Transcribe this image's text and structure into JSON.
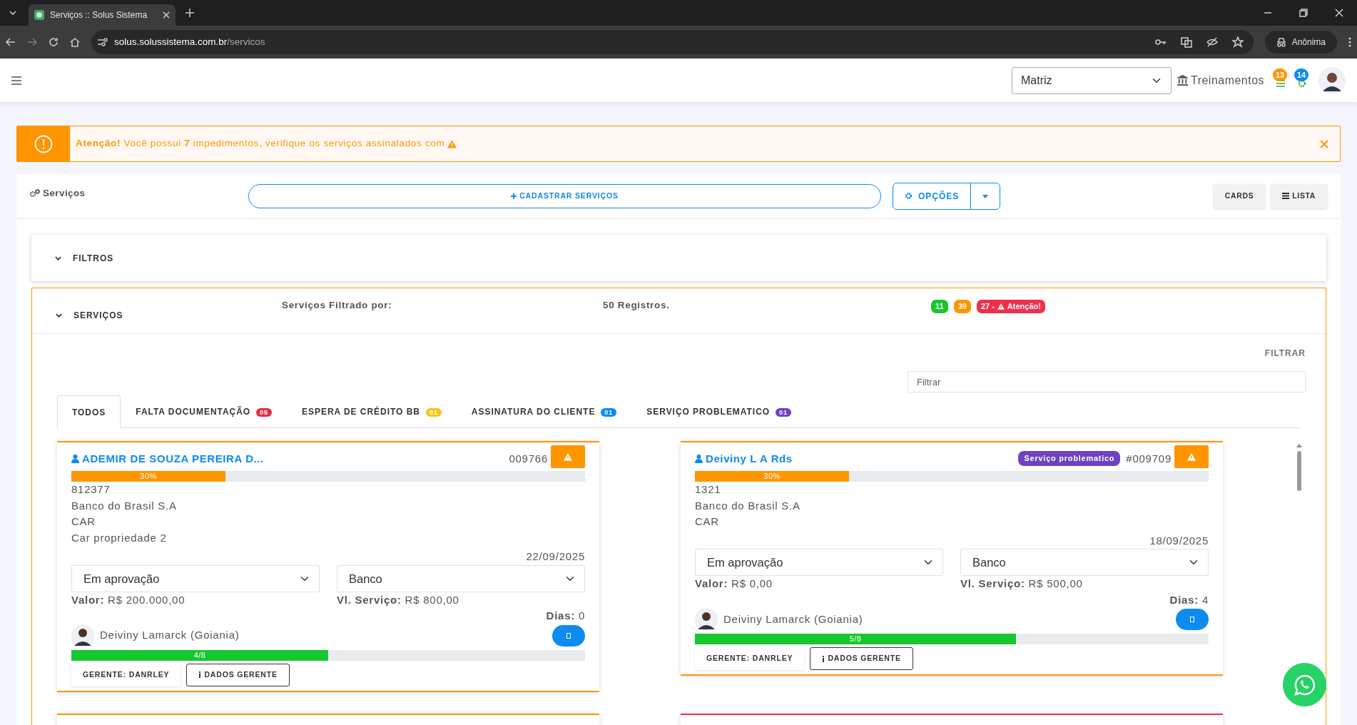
{
  "browser": {
    "tab_title": "Serviços :: Solus Sistema",
    "url_host": "solus.solussistema.com.br",
    "url_path": "/servicos",
    "profile": "Anônima"
  },
  "header": {
    "branch": "Matriz",
    "trainings": "Treinamentos",
    "notifications": [
      {
        "count": "13",
        "color": "#ff9500"
      },
      {
        "count": "14",
        "color": "#0d8bf2"
      }
    ]
  },
  "alert": {
    "text": "**Atenção!** Você possui **7** impedimentos, verifique os serviços assinalados com"
  },
  "services": {
    "title": "Serviços",
    "add_button": "CADASTRAR SERVIÇOS",
    "options_button": "OPÇÕES",
    "view_buttons": [
      "CARDS",
      "LISTA"
    ]
  },
  "filters": {
    "label": "FILTROS"
  },
  "list": {
    "label": "SERVIÇOS",
    "filtered_by": "Serviços Filtrado por:",
    "records": "50 Registros.",
    "counters": [
      {
        "kind": "plain",
        "text": "11",
        "color": "#16c72e"
      },
      {
        "kind": "plain",
        "text": "39",
        "color": "#ff9500"
      },
      {
        "kind": "warning",
        "text": "27 -",
        "note": "Atenção!",
        "color": "#f0304a"
      }
    ]
  },
  "filter": {
    "label": "FILTRAR",
    "placeholder": "Filtrar"
  },
  "tabs": [
    {
      "label": "TODOS",
      "selected": true
    },
    {
      "label": "FALTA DOCUMENTAÇÃO",
      "count": "05",
      "color": "#e02e44",
      "selected": false
    },
    {
      "label": "ESPERA DE CRÉDITO BB",
      "count": "01",
      "color": "#f5c518",
      "selected": false
    },
    {
      "label": "ASSINATURA DO CLIENTE",
      "count": "01",
      "color": "#0d8bf2",
      "selected": false
    },
    {
      "label": "SERVIÇO PROBLEMATICO",
      "count": "01",
      "color": "#6f42c1",
      "selected": false
    }
  ],
  "cards": [
    {
      "color": "#ff9500",
      "client": "ADEMIR DE SOUZA PEREIRA D...",
      "number": "009766",
      "progress": {
        "label": "30%",
        "level": 0.3
      },
      "lines": [
        "812377",
        "Banco do Brasil S.A",
        "CAR",
        "Car propriedade 2"
      ],
      "date": "22/09/2025",
      "status": "Em aprovação",
      "type": "Banco",
      "value_label": "Valor:",
      "value": "R$ 200.000,00",
      "service_value_label": "Vl. Serviço:",
      "service_value": "R$ 800,00",
      "days_label": "Dias:",
      "days": "0",
      "responsible": "Deiviny Lamarck (Goiania)",
      "steps": {
        "label": "4/8",
        "level": 0.5
      },
      "manager": "GERENTE: DANRLEY",
      "manager_button": "DADOS GERENTE"
    },
    {
      "color": "#ff9500",
      "client": "Deiviny L A Rds",
      "tag": "Serviço problematico",
      "number": "#009709",
      "progress": {
        "label": "30%",
        "level": 0.3
      },
      "lines": [
        "1321",
        "Banco do Brasil S.A",
        "CAR"
      ],
      "date": "18/09/2025",
      "status": "Em aprovação",
      "type": "Banco",
      "value_label": "Valor:",
      "value": "R$ 0,00",
      "service_value_label": "Vl. Serviço:",
      "service_value": "R$ 500,00",
      "days_label": "Dias:",
      "days": "4",
      "responsible": "Deiviny Lamarck (Goiania)",
      "steps": {
        "label": "5/8",
        "level": 0.625
      },
      "manager": "GERENTE: DANRLEY",
      "manager_button": "DADOS GERENTE"
    }
  ],
  "next_cards": [
    {
      "color": "#ff9500"
    },
    {
      "color": "#f0304a"
    }
  ]
}
